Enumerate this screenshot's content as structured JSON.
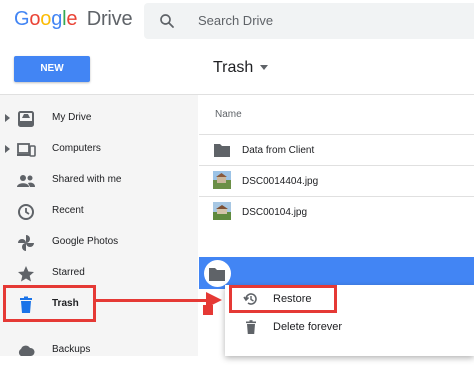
{
  "header": {
    "logo_google": "Google",
    "logo_product": "Drive",
    "search_placeholder": "Search Drive"
  },
  "toolbar": {
    "new_label": "NEW",
    "breadcrumb": "Trash"
  },
  "sidebar": {
    "items": [
      {
        "label": "My Drive",
        "icon": "my-drive-icon",
        "expandable": true
      },
      {
        "label": "Computers",
        "icon": "computers-icon",
        "expandable": true
      },
      {
        "label": "Shared with me",
        "icon": "people-icon",
        "expandable": false
      },
      {
        "label": "Recent",
        "icon": "clock-icon",
        "expandable": false
      },
      {
        "label": "Google Photos",
        "icon": "pinwheel-icon",
        "expandable": false
      },
      {
        "label": "Starred",
        "icon": "star-icon",
        "expandable": false
      },
      {
        "label": "Trash",
        "icon": "trash-icon",
        "expandable": false,
        "active": true
      },
      {
        "label": "Backups",
        "icon": "cloud-icon",
        "expandable": false
      }
    ]
  },
  "list": {
    "column_header": "Name",
    "files": [
      {
        "name": "Data from Client",
        "type": "folder"
      },
      {
        "name": "DSC0014404.jpg",
        "type": "image"
      },
      {
        "name": "DSC00104.jpg",
        "type": "image"
      },
      {
        "name": "",
        "type": "folder",
        "selected": true
      }
    ]
  },
  "context_menu": {
    "items": [
      {
        "label": "Restore",
        "icon": "restore-icon"
      },
      {
        "label": "Delete forever",
        "icon": "trash-icon"
      }
    ]
  },
  "colors": {
    "accent": "#4285f4",
    "annotation": "#e53935",
    "trash_active": "#1a73e8"
  }
}
